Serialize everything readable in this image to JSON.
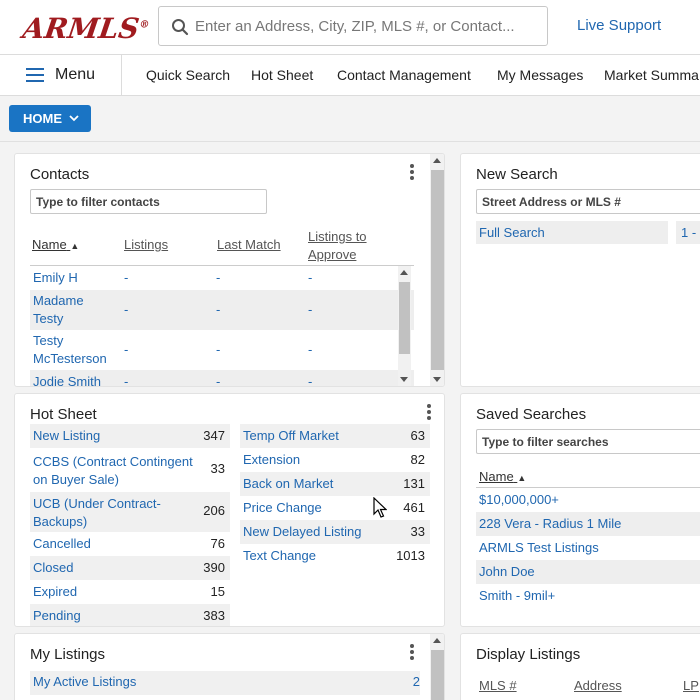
{
  "header": {
    "logo": "ARMLS",
    "logo_mark": "®",
    "search_placeholder": "Enter an Address, City, ZIP, MLS #, or Contact...",
    "live_support": "Live Support"
  },
  "nav": {
    "menu_label": "Menu",
    "items": [
      "Quick Search",
      "Hot Sheet",
      "Contact Management",
      "My Messages",
      "Market Summa"
    ]
  },
  "home_button": "HOME",
  "contacts": {
    "title": "Contacts",
    "filter_placeholder": "Type to filter contacts",
    "columns": [
      "Name",
      "Listings",
      "Last Match",
      "Listings to Approve"
    ],
    "rows": [
      {
        "name": "Emily H",
        "listings": "-",
        "last_match": "-",
        "approve": "-"
      },
      {
        "name": "Madame Testy",
        "listings": "-",
        "last_match": "-",
        "approve": "-"
      },
      {
        "name": "Testy McTesterson",
        "listings": "-",
        "last_match": "-",
        "approve": "-"
      },
      {
        "name": "Jodie Smith",
        "listings": "-",
        "last_match": "-",
        "approve": "-"
      }
    ]
  },
  "new_search": {
    "title": "New Search",
    "input_placeholder": "Street Address or MLS #",
    "full_search": "Full Search",
    "range_text": "1 -"
  },
  "hot_sheet": {
    "title": "Hot Sheet",
    "left": [
      {
        "label": "New Listing",
        "count": "347"
      },
      {
        "label": "CCBS (Contract Contingent on Buyer Sale)",
        "count": "33"
      },
      {
        "label": "UCB (Under Contract-Backups)",
        "count": "206"
      },
      {
        "label": "Cancelled",
        "count": "76"
      },
      {
        "label": "Closed",
        "count": "390"
      },
      {
        "label": "Expired",
        "count": "15"
      },
      {
        "label": "Pending",
        "count": "383"
      }
    ],
    "right": [
      {
        "label": "Temp Off Market",
        "count": "63"
      },
      {
        "label": "Extension",
        "count": "82"
      },
      {
        "label": "Back on Market",
        "count": "131"
      },
      {
        "label": "Price Change",
        "count": "461"
      },
      {
        "label": "New Delayed Listing",
        "count": "33"
      },
      {
        "label": "Text Change",
        "count": "1013"
      }
    ]
  },
  "saved_searches": {
    "title": "Saved Searches",
    "filter_placeholder": "Type to filter searches",
    "column": "Name",
    "items": [
      "$10,000,000+",
      "228 Vera - Radius 1 Mile",
      "ARMLS Test Listings",
      "John Doe",
      "Smith - 9mil+"
    ]
  },
  "my_listings": {
    "title": "My Listings",
    "rows": [
      {
        "label": "My Active Listings",
        "count": "2"
      }
    ]
  },
  "display_listings": {
    "title": "Display Listings",
    "columns": [
      "MLS #",
      "Address",
      "LP"
    ]
  }
}
